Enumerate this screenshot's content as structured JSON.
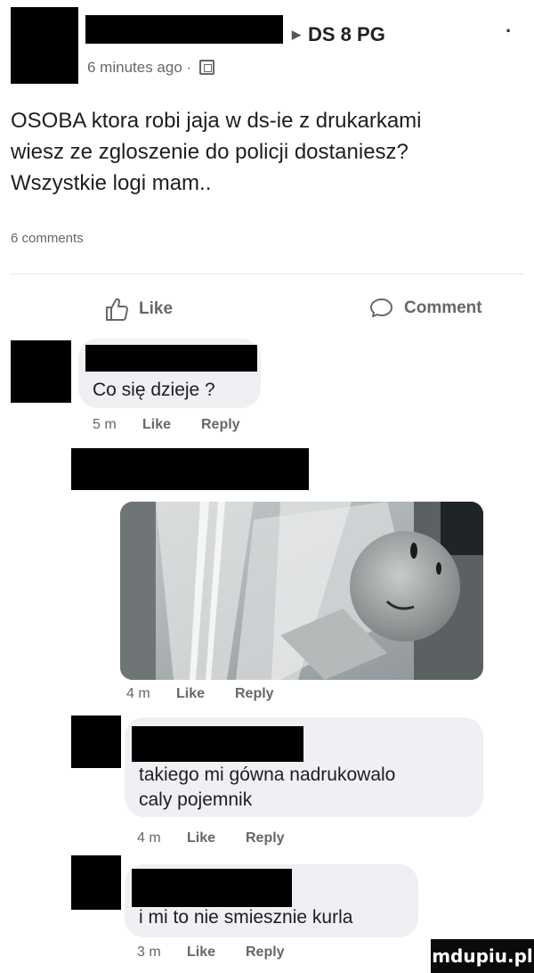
{
  "post": {
    "group_name": "DS 8 PG",
    "time_ago": "6 minutes ago ·",
    "text_lines": [
      "OSOBA ktora robi jaja w ds-ie z drukarkami",
      "wiesz ze zgloszenie do policji dostaniesz?",
      "Wszystkie logi mam.."
    ],
    "comments_count": "6 comments",
    "actions": {
      "like": "Like",
      "comment": "Comment"
    }
  },
  "comments": [
    {
      "text": "Co się dzieje ?",
      "time": "5 m",
      "like": "Like",
      "reply": "Reply"
    },
    {
      "text": "",
      "time": "4 m",
      "like": "Like",
      "reply": "Reply",
      "has_photo": true
    },
    {
      "text_lines": [
        "takiego mi gówna nadrukowalo",
        "caly pojemnik"
      ],
      "time": "4 m",
      "like": "Like",
      "reply": "Reply"
    },
    {
      "text": "i mi to nie smiesznie kurla",
      "time": "3 m",
      "like": "Like",
      "reply": "Reply"
    }
  ],
  "watermark": "mdupiu.pl",
  "colors": {
    "meta_gray": "#65676b",
    "bubble": "#eef0f3",
    "text": "#1c1e21",
    "redaction": "#000000"
  },
  "icons": [
    "triangle-right-icon",
    "more-icon",
    "public-page-icon",
    "thumbs-up-icon",
    "comment-bubble-icon"
  ]
}
